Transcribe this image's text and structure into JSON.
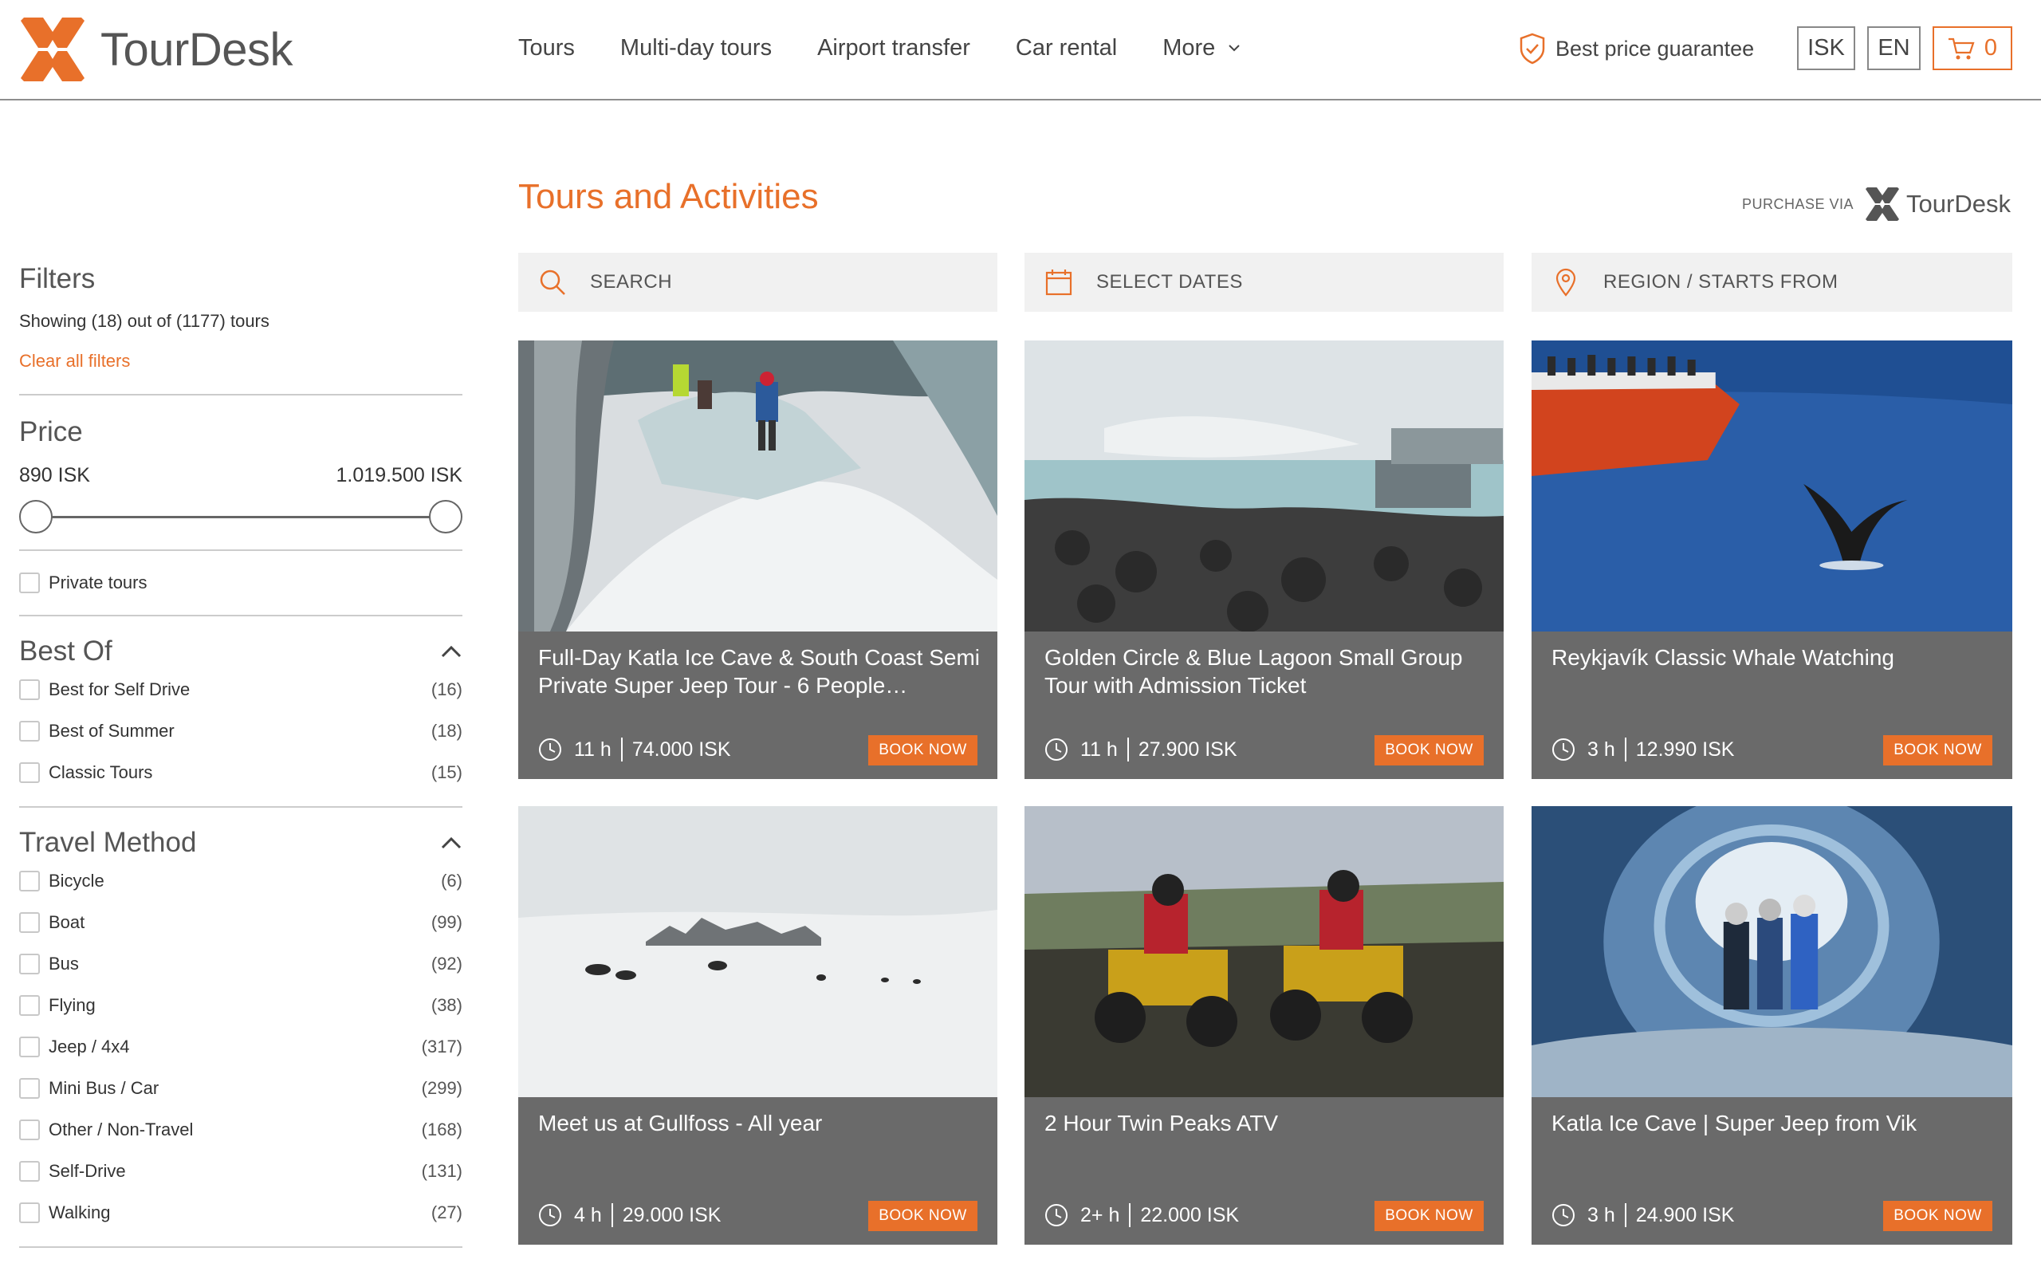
{
  "brand": {
    "name": "TourDesk",
    "accent": "#e8702a"
  },
  "nav": {
    "items": [
      "Tours",
      "Multi-day tours",
      "Airport transfer",
      "Car rental",
      "More"
    ]
  },
  "header": {
    "guarantee": "Best price guarantee",
    "currency": "ISK",
    "language": "EN",
    "cart_count": "0"
  },
  "page": {
    "title": "Tours and Activities",
    "purchase_via": "PURCHASE VIA",
    "purchase_brand": "TourDesk"
  },
  "search": {
    "search_label": "SEARCH",
    "dates_label": "SELECT DATES",
    "region_label": "REGION / STARTS FROM"
  },
  "filters": {
    "title": "Filters",
    "showing": "Showing (18) out of (1177) tours",
    "clear": "Clear all filters",
    "price": {
      "title": "Price",
      "min": "890 ISK",
      "max": "1.019.500 ISK",
      "range_low": 0,
      "range_high": 1
    },
    "private": {
      "label": "Private tours"
    },
    "best_of": {
      "title": "Best Of",
      "options": [
        {
          "label": "Best for Self Drive",
          "count": "(16)"
        },
        {
          "label": "Best of Summer",
          "count": "(18)"
        },
        {
          "label": "Classic Tours",
          "count": "(15)"
        }
      ]
    },
    "travel_method": {
      "title": "Travel Method",
      "options": [
        {
          "label": "Bicycle",
          "count": "(6)"
        },
        {
          "label": "Boat",
          "count": "(99)"
        },
        {
          "label": "Bus",
          "count": "(92)"
        },
        {
          "label": "Flying",
          "count": "(38)"
        },
        {
          "label": "Jeep / 4x4",
          "count": "(317)"
        },
        {
          "label": "Mini Bus / Car",
          "count": "(299)"
        },
        {
          "label": "Other / Non-Travel",
          "count": "(168)"
        },
        {
          "label": "Self-Drive",
          "count": "(131)"
        },
        {
          "label": "Walking",
          "count": "(27)"
        }
      ]
    }
  },
  "book_label": "BOOK NOW",
  "tours": [
    {
      "title": "Full-Day Katla Ice Cave & South Coast Semi Private Super Jeep Tour - 6 People…",
      "duration": "11 h",
      "price": "74.000 ISK",
      "image": "ice-cave-hikers"
    },
    {
      "title": "Golden Circle & Blue Lagoon Small Group Tour with Admission Ticket",
      "duration": "11 h",
      "price": "27.900 ISK",
      "image": "blue-lagoon"
    },
    {
      "title": "Reykjavík Classic Whale Watching",
      "duration": "3 h",
      "price": "12.990 ISK",
      "image": "whale-tail-boat"
    },
    {
      "title": "Meet us at Gullfoss - All year",
      "duration": "4 h",
      "price": "29.000 ISK",
      "image": "snowmobiles-glacier"
    },
    {
      "title": "2 Hour Twin Peaks ATV",
      "duration": "2+ h",
      "price": "22.000 ISK",
      "image": "atv-riders"
    },
    {
      "title": "Katla Ice Cave | Super Jeep from Vik",
      "duration": "3 h",
      "price": "24.900 ISK",
      "image": "blue-ice-cave"
    }
  ]
}
